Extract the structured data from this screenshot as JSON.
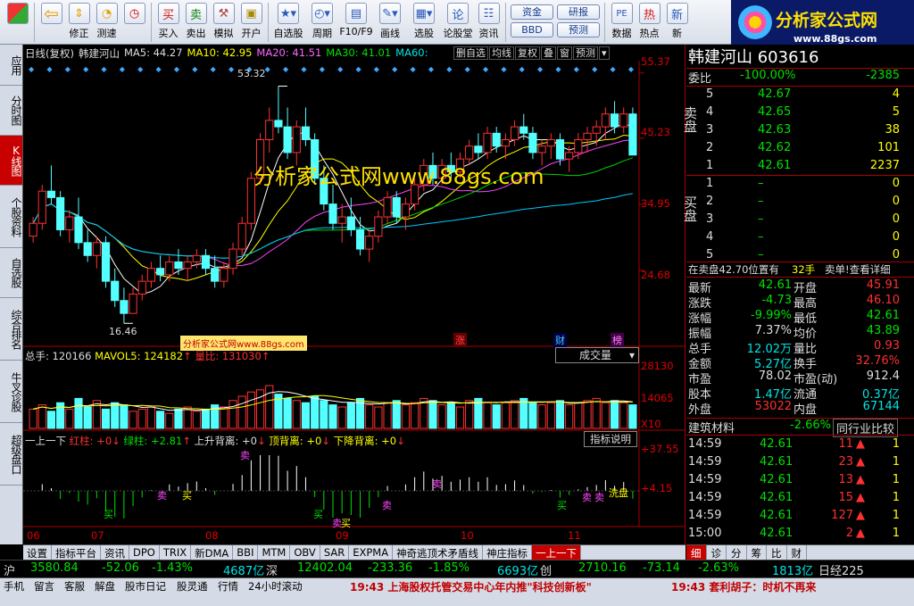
{
  "toolbar": {
    "items": [
      {
        "label": "",
        "icon": "home-icon"
      },
      {
        "label": "",
        "icon": "back-arrow-icon"
      },
      {
        "label": "修正",
        "icon": "up-down-arrows-icon"
      },
      {
        "label": "测速",
        "icon": "speed-icon"
      },
      {
        "label": "",
        "icon": "clock-icon"
      },
      {
        "label": "买入",
        "icon": "buy-icon",
        "glyph": "买"
      },
      {
        "label": "卖出",
        "icon": "sell-icon",
        "glyph": "卖"
      },
      {
        "label": "模拟",
        "icon": "hammer-icon"
      },
      {
        "label": "开户",
        "icon": "lock-icon"
      },
      {
        "label": "自选股",
        "icon": "star-icon"
      },
      {
        "label": "周期",
        "icon": "cycle-icon"
      },
      {
        "label": "F10/F9",
        "icon": "f10-icon"
      },
      {
        "label": "画线",
        "icon": "pen-icon"
      },
      {
        "label": "选股",
        "icon": "select-icon"
      },
      {
        "label": "论股堂",
        "icon": "forum-icon",
        "glyph": "论"
      },
      {
        "label": "资讯",
        "icon": "info-icon"
      }
    ],
    "pair1": [
      "资金",
      "BBD"
    ],
    "pair2": [
      "研报",
      "预测"
    ],
    "tail": [
      {
        "label": "数据",
        "glyph": "PE"
      },
      {
        "label": "热点",
        "glyph": "热"
      },
      {
        "label": "新",
        "glyph": "新"
      }
    ]
  },
  "logo": {
    "title": "分析家公式网",
    "url": "www.88gs.com"
  },
  "left_tabs": [
    {
      "label": "应用"
    },
    {
      "label": "分时图"
    },
    {
      "label": "K线图",
      "active": true
    },
    {
      "label": "个股资料"
    },
    {
      "label": "自选股"
    },
    {
      "label": "综合排名"
    },
    {
      "label": "牛叉诊股"
    },
    {
      "label": "超级盘口"
    }
  ],
  "chart": {
    "header": {
      "period": "日线(复权)",
      "name": "韩建河山",
      "ma5": "MA5: 44.27",
      "ma10": "MA10: 42.95",
      "ma20": "MA20: 41.51",
      "ma30": "MA30: 41.01",
      "ma60": "MA60:"
    },
    "header_buttons": [
      "删自选",
      "均线",
      "复权",
      "叠",
      "窗",
      "预测"
    ],
    "watermark": "分析家公式网www.88gs.com",
    "watermark_small": "分析家公式网www.88gs.com",
    "high_label": "53.32",
    "low_label": "16.46",
    "y_labels": [
      "55.37",
      "45.23",
      "34.95",
      "24.68"
    ],
    "event_tags": [
      "涨",
      "财",
      "榜"
    ],
    "vol_header": {
      "total": "总手: 120166",
      "mavol": "MAVOL5: 124182",
      "ratio": "量比: 131030"
    },
    "vol_dropdown": "成交量",
    "vol_y": [
      "28130",
      "14065",
      "X10"
    ],
    "ind_header": {
      "name": "一上一下",
      "red": "红柱: +0",
      "green": "绿柱: +2.81",
      "up": "上升背离: +0",
      "top": "顶背离: +0",
      "down": "下降背离: +0"
    },
    "ind_button": "指标说明",
    "ind_y": [
      "+37.55",
      "+4.15"
    ],
    "ind_tags": [
      "卖",
      "买",
      "买",
      "卖",
      "卖",
      "买",
      "买",
      "卖",
      "卖",
      "买",
      "卖",
      "卖",
      "洗盘"
    ],
    "x_labels": [
      "06",
      "07",
      "08",
      "09",
      "10",
      "11"
    ]
  },
  "chart_data": {
    "type": "candlestick",
    "title": "韩建河山",
    "ohlc": [
      [
        30,
        33,
        29,
        32
      ],
      [
        32,
        38,
        31,
        37
      ],
      [
        37,
        41,
        35,
        36
      ],
      [
        36,
        37,
        30,
        31
      ],
      [
        31,
        34,
        29,
        33
      ],
      [
        33,
        36,
        28,
        29
      ],
      [
        29,
        31,
        26,
        27
      ],
      [
        27,
        30,
        25,
        29
      ],
      [
        29,
        30,
        22,
        23
      ],
      [
        23,
        25,
        19,
        20
      ],
      [
        20,
        22,
        16.46,
        18
      ],
      [
        18,
        22,
        18,
        21
      ],
      [
        21,
        24,
        20,
        23
      ],
      [
        23,
        26,
        22,
        25
      ],
      [
        25,
        27,
        23,
        24
      ],
      [
        24,
        27,
        23,
        26
      ],
      [
        26,
        28,
        24,
        25
      ],
      [
        25,
        27,
        23,
        26
      ],
      [
        26,
        28,
        25,
        27
      ],
      [
        27,
        28,
        24,
        25
      ],
      [
        25,
        27,
        22,
        23
      ],
      [
        23,
        26,
        22,
        25
      ],
      [
        25,
        29,
        24,
        28
      ],
      [
        28,
        33,
        27,
        32
      ],
      [
        32,
        40,
        31,
        39
      ],
      [
        39,
        46,
        38,
        45
      ],
      [
        45,
        50,
        43,
        48
      ],
      [
        48,
        53.32,
        46,
        47
      ],
      [
        47,
        50,
        42,
        43
      ],
      [
        43,
        48,
        41,
        47
      ],
      [
        47,
        50,
        44,
        45
      ],
      [
        45,
        46,
        38,
        39
      ],
      [
        39,
        41,
        34,
        35
      ],
      [
        35,
        38,
        31,
        32
      ],
      [
        32,
        35,
        29,
        33
      ],
      [
        33,
        36,
        30,
        31
      ],
      [
        31,
        33,
        27,
        28
      ],
      [
        28,
        31,
        26,
        30
      ],
      [
        30,
        34,
        29,
        33
      ],
      [
        33,
        37,
        32,
        36
      ],
      [
        36,
        37,
        32,
        33
      ],
      [
        33,
        36,
        31,
        35
      ],
      [
        35,
        39,
        34,
        38
      ],
      [
        38,
        42,
        37,
        41
      ],
      [
        41,
        43,
        38,
        39
      ],
      [
        39,
        42,
        38,
        41
      ],
      [
        41,
        43,
        39,
        40
      ],
      [
        40,
        43,
        39,
        42
      ],
      [
        42,
        45,
        41,
        44
      ],
      [
        44,
        46,
        42,
        43
      ],
      [
        43,
        47,
        42,
        46
      ],
      [
        46,
        47,
        43,
        44
      ],
      [
        44,
        46,
        42,
        45
      ],
      [
        45,
        48,
        44,
        47
      ],
      [
        47,
        49,
        45,
        46
      ],
      [
        46,
        47,
        42,
        43
      ],
      [
        43,
        45,
        41,
        44
      ],
      [
        44,
        46,
        42,
        45
      ],
      [
        45,
        46,
        41,
        42
      ],
      [
        42,
        44,
        40,
        43
      ],
      [
        43,
        46,
        42,
        45
      ],
      [
        45,
        47,
        43,
        46
      ],
      [
        46,
        48,
        44,
        47
      ],
      [
        47,
        50,
        45,
        49
      ],
      [
        49,
        51,
        46,
        47
      ],
      [
        47,
        50,
        46,
        49
      ],
      [
        49,
        50,
        42.61,
        42.61
      ]
    ],
    "close_labels": {
      "high": 53.32,
      "low": 16.46
    },
    "ylim": [
      14,
      57
    ],
    "volume": [
      9,
      11,
      8,
      12,
      9,
      14,
      10,
      13,
      9,
      12,
      11,
      8,
      9,
      10,
      8,
      7,
      9,
      10,
      8,
      9,
      11,
      10,
      13,
      15,
      17,
      18,
      20,
      16,
      14,
      13,
      12,
      15,
      13,
      11,
      10,
      12,
      14,
      11,
      10,
      12,
      13,
      11,
      12,
      14,
      13,
      11,
      12,
      10,
      13,
      14,
      12,
      11,
      12,
      13,
      14,
      12,
      11,
      12,
      13,
      11,
      12,
      13,
      14,
      12,
      13,
      12,
      11
    ],
    "volume_ylim": [
      0,
      30
    ]
  },
  "quote": {
    "name": "韩建河山",
    "code": "603616",
    "webi_label": "委比",
    "webi": "-100.00%",
    "webi_diff": "-2385",
    "sell_label": "卖盘",
    "buy_label": "买盘",
    "asks": [
      {
        "lv": "5",
        "p": "42.67",
        "v": "4"
      },
      {
        "lv": "4",
        "p": "42.65",
        "v": "5"
      },
      {
        "lv": "3",
        "p": "42.63",
        "v": "38"
      },
      {
        "lv": "2",
        "p": "42.62",
        "v": "101"
      },
      {
        "lv": "1",
        "p": "42.61",
        "v": "2237"
      }
    ],
    "bids": [
      {
        "lv": "1",
        "p": "–",
        "v": "0"
      },
      {
        "lv": "2",
        "p": "–",
        "v": "0"
      },
      {
        "lv": "3",
        "p": "–",
        "v": "0"
      },
      {
        "lv": "4",
        "p": "–",
        "v": "0"
      },
      {
        "lv": "5",
        "p": "–",
        "v": "0"
      }
    ],
    "pos_text": "在卖盘42.70位置有",
    "pos_vol": "32手",
    "pos_tail": "卖单!查看详细",
    "stats": [
      {
        "k1": "最新",
        "v1": "42.61",
        "k2": "开盘",
        "v2": "45.91"
      },
      {
        "k1": "涨跌",
        "v1": "-4.73",
        "k2": "最高",
        "v2": "46.10"
      },
      {
        "k1": "涨幅",
        "v1": "-9.99%",
        "k2": "最低",
        "v2": "42.61"
      },
      {
        "k1": "振幅",
        "v1": "7.37%",
        "k2": "均价",
        "v2": "43.89"
      },
      {
        "k1": "总手",
        "v1": "12.02万",
        "k2": "量比",
        "v2": "0.93"
      },
      {
        "k1": "金额",
        "v1": "5.27亿",
        "k2": "换手",
        "v2": "32.76%"
      },
      {
        "k1": "市盈",
        "v1": "78.02",
        "k2": "市盈(动)",
        "v2": "912.4"
      },
      {
        "k1": "股本",
        "v1": "1.47亿",
        "k2": "流通",
        "v2": "0.37亿"
      },
      {
        "k1": "外盘",
        "v1": "53022",
        "k2": "内盘",
        "v2": "67144"
      }
    ],
    "industry": "建筑材料",
    "industry_pct": "-2.66%",
    "industry_btn": "同行业比较",
    "ticks": [
      {
        "t": "14:59",
        "p": "42.61",
        "v": "11",
        "x": "1"
      },
      {
        "t": "14:59",
        "p": "42.61",
        "v": "23",
        "x": "1"
      },
      {
        "t": "14:59",
        "p": "42.61",
        "v": "13",
        "x": "1"
      },
      {
        "t": "14:59",
        "p": "42.61",
        "v": "15",
        "x": "1"
      },
      {
        "t": "14:59",
        "p": "42.61",
        "v": "127",
        "x": "1"
      },
      {
        "t": "15:00",
        "p": "42.61",
        "v": "2",
        "x": "1"
      }
    ]
  },
  "bottom_tabs": [
    "设置",
    "指标平台",
    "资讯",
    "DPO",
    "TRIX",
    "新DMA",
    "BBI",
    "MTM",
    "OBV",
    "SAR",
    "EXPMA",
    "神奇逃顶术矛盾线",
    "神庄指标",
    "一上一下"
  ],
  "bottom_tabs_right": [
    "细",
    "诊",
    "分",
    "筹",
    "比",
    "财"
  ],
  "index_bar": {
    "sh_label": "沪",
    "sh": "3580.84",
    "sh_chg": "-52.06",
    "sh_pct": "-1.43%",
    "sh_amt": "4687亿",
    "sz_label": "深",
    "sz": "12402.04",
    "sz_chg": "-233.36",
    "sz_pct": "-1.85%",
    "sz_amt": "6693亿",
    "cy_label": "创",
    "cy": "2710.16",
    "cy_chg": "-73.14",
    "cy_pct": "-2.63%",
    "cy_amt": "1813亿",
    "zj_label": "日经225"
  },
  "status": {
    "links": [
      "手机",
      "留言",
      "客服",
      "解盘",
      "股市日记",
      "股灵通",
      "行情",
      "24小时滚动"
    ],
    "news1": "19:43 上海股权托管交易中心年内推\"科技创新板\"",
    "news2": "19:43 套利胡子：时机不再来"
  }
}
